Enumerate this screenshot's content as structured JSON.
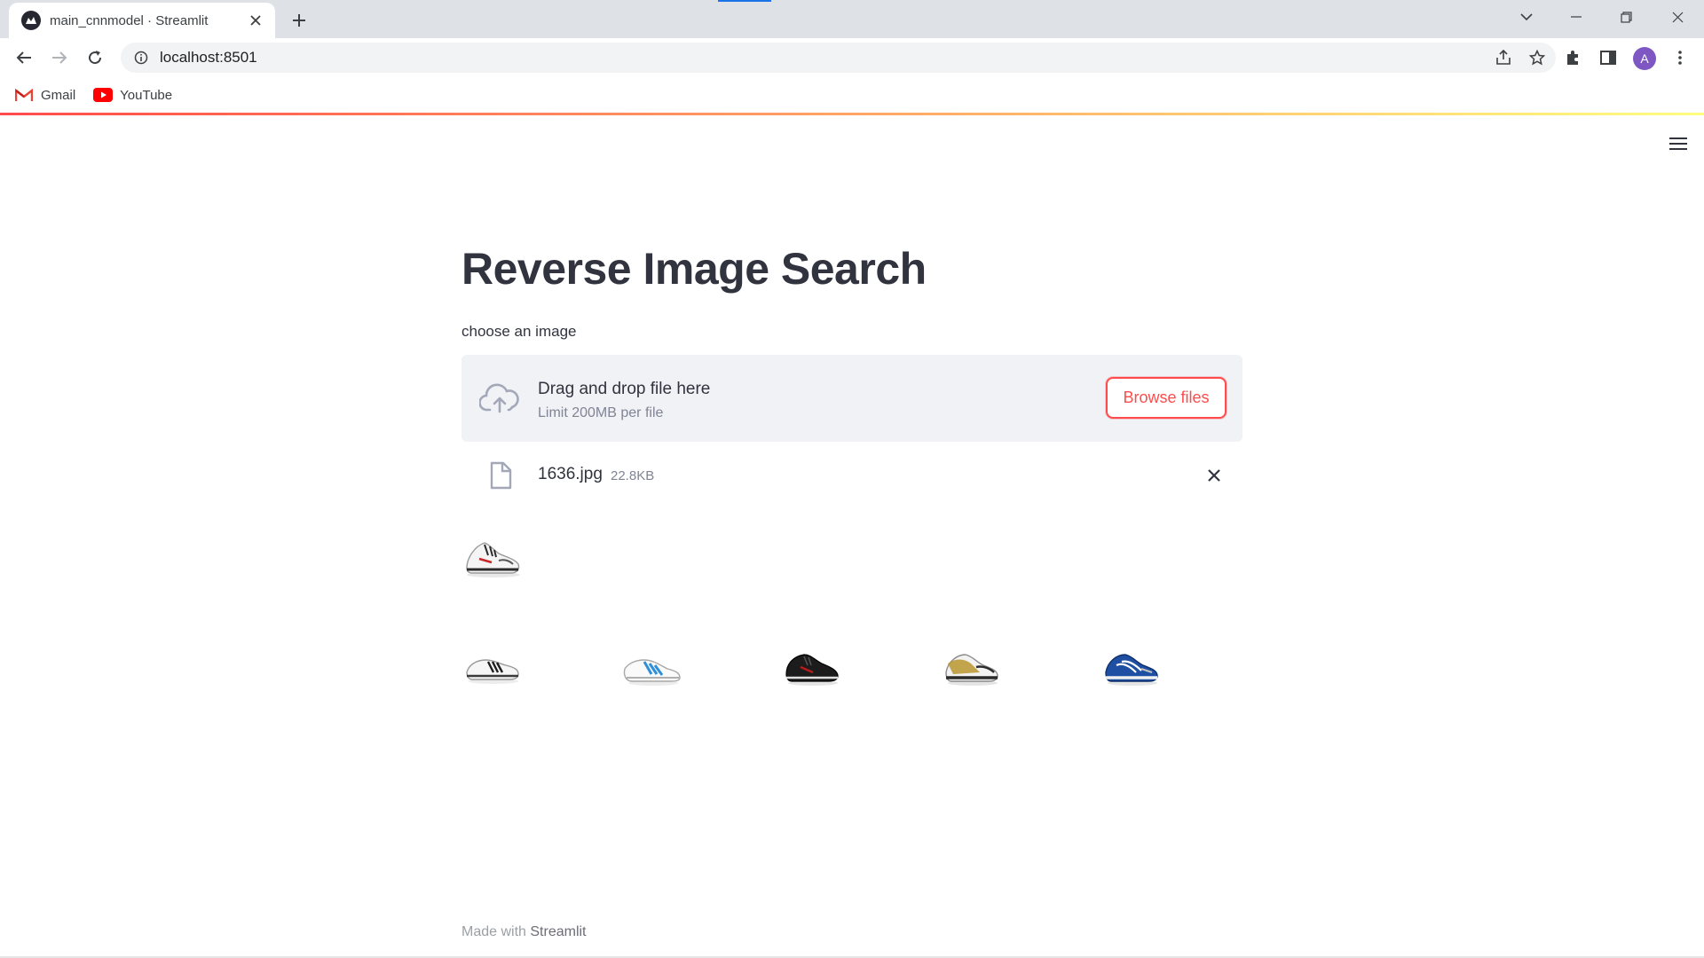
{
  "browser": {
    "tab_title": "main_cnnmodel · Streamlit",
    "url": "localhost:8501",
    "avatar_initial": "A",
    "bookmarks": [
      {
        "label": "Gmail",
        "icon": "gmail-icon"
      },
      {
        "label": "YouTube",
        "icon": "youtube-icon"
      }
    ]
  },
  "page": {
    "title": "Reverse Image Search",
    "uploader_label": "choose an image",
    "dropzone": {
      "title": "Drag and drop file here",
      "limit": "Limit 200MB per file",
      "button": "Browse files",
      "icon": "cloud-upload-icon"
    },
    "uploaded_file": {
      "name": "1636.jpg",
      "size": "22.8KB"
    },
    "query_image": {
      "name": "query-shoe-image",
      "desc": "white sneaker"
    },
    "results": [
      {
        "name": "result-image-1",
        "desc": "white shoe with black stripes"
      },
      {
        "name": "result-image-2",
        "desc": "white shoe with blue stripes"
      },
      {
        "name": "result-image-3",
        "desc": "black shoe"
      },
      {
        "name": "result-image-4",
        "desc": "white and gold shoe"
      },
      {
        "name": "result-image-5",
        "desc": "blue running shoe"
      }
    ],
    "footer": {
      "prefix": "Made with ",
      "brand": "Streamlit"
    }
  },
  "colors": {
    "accent": "#ff4b4b",
    "dropzone_bg": "#f0f2f6",
    "text": "#31333f",
    "muted": "#808495"
  }
}
